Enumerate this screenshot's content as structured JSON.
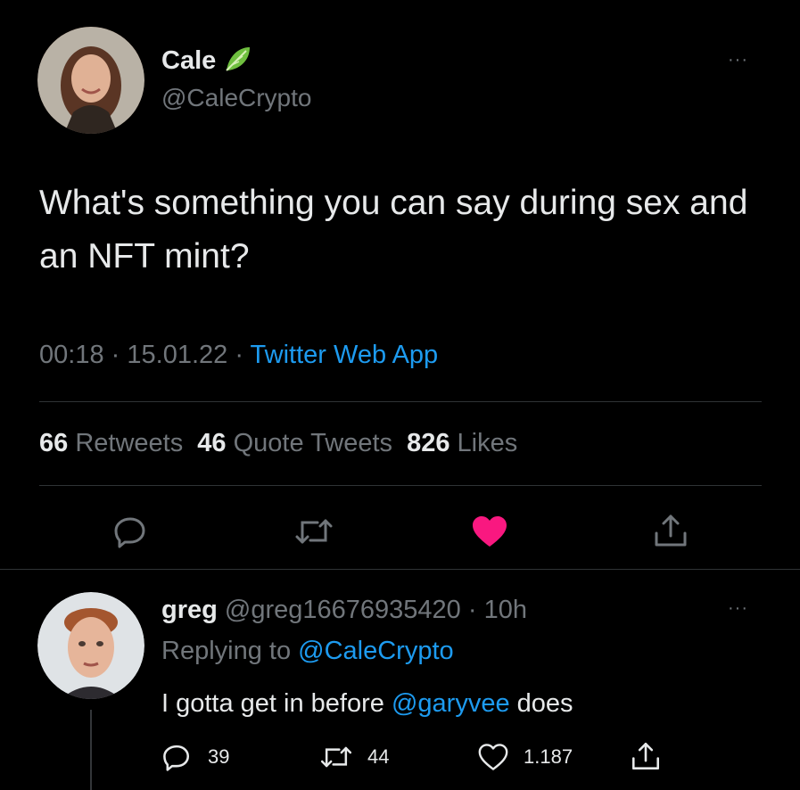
{
  "tweet": {
    "author": {
      "name": "Cale",
      "handle": "@CaleCrypto",
      "name_emoji": "leafy-green-icon"
    },
    "text": "What's something you can say during sex and an NFT mint?",
    "time": "00:18",
    "date": "15.01.22",
    "source": "Twitter Web App",
    "sep": "·",
    "stats": {
      "retweets_count": "66",
      "retweets_label": "Retweets",
      "quotes_count": "46",
      "quotes_label": "Quote Tweets",
      "likes_count": "826",
      "likes_label": "Likes"
    },
    "actions": [
      "reply-icon",
      "retweet-icon",
      "liked-heart-icon",
      "share-icon"
    ],
    "more": "···"
  },
  "reply": {
    "author": {
      "name": "greg",
      "handle": "@greg16676935420",
      "age": "10h"
    },
    "replying_to_label": "Replying to",
    "replying_to_handle": "@CaleCrypto",
    "text_before": "I gotta get in before",
    "mention": "@garyvee",
    "text_after": "does",
    "counts": {
      "replies": "39",
      "retweets": "44",
      "likes": "1.187"
    },
    "more": "···"
  },
  "colors": {
    "background": "#000000",
    "text": "#e7e9ea",
    "muted": "#71767b",
    "link": "#1d9bf0",
    "like": "#f91880",
    "divider": "#2f3336"
  }
}
